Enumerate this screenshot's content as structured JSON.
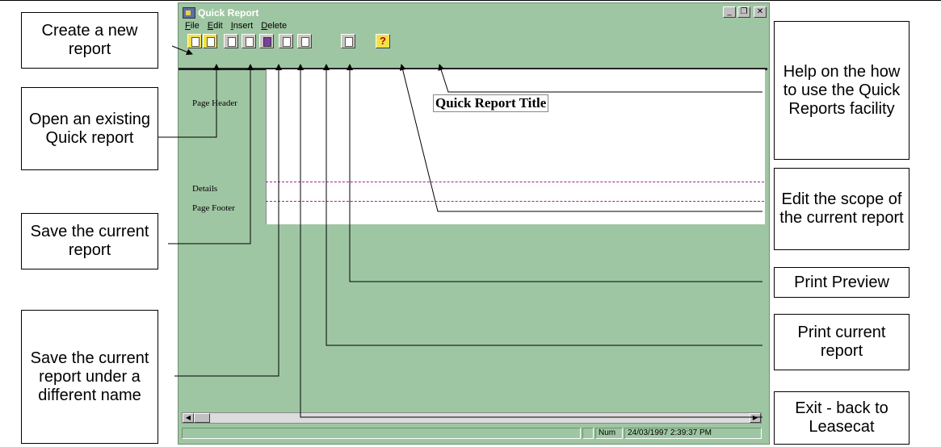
{
  "window": {
    "title": "Quick Report",
    "menu": [
      {
        "pre": "",
        "u": "F",
        "post": "ile"
      },
      {
        "pre": "",
        "u": "E",
        "post": "dit"
      },
      {
        "pre": "",
        "u": "I",
        "post": "nsert"
      },
      {
        "pre": "",
        "u": "D",
        "post": "elete"
      }
    ],
    "controls": {
      "minimize": "_",
      "restore": "❐",
      "close": "✕"
    }
  },
  "toolbar": {
    "help_glyph": "?"
  },
  "report": {
    "page_header_label": "Page Header",
    "details_label": "Details",
    "page_footer_label": "Page Footer",
    "title": "Quick Report Title"
  },
  "status": {
    "num": "Num",
    "datetime": "24/03/1997 2:39:37 PM"
  },
  "callouts": {
    "new_report": "Create a new report",
    "open_report": "Open an existing Quick report",
    "save_report": "Save the current report",
    "save_as": "Save the current report under a different name",
    "help": "Help on the how to use the Quick Reports facility",
    "edit_scope": "Edit the scope of the current report",
    "print_preview": "Print Preview",
    "print_current": "Print current report",
    "exit": "Exit - back to Leasecat"
  },
  "colors": {
    "window_bg": "#9fc6a3",
    "band_line": "#a020a0",
    "help_button": "#f2e24a"
  }
}
